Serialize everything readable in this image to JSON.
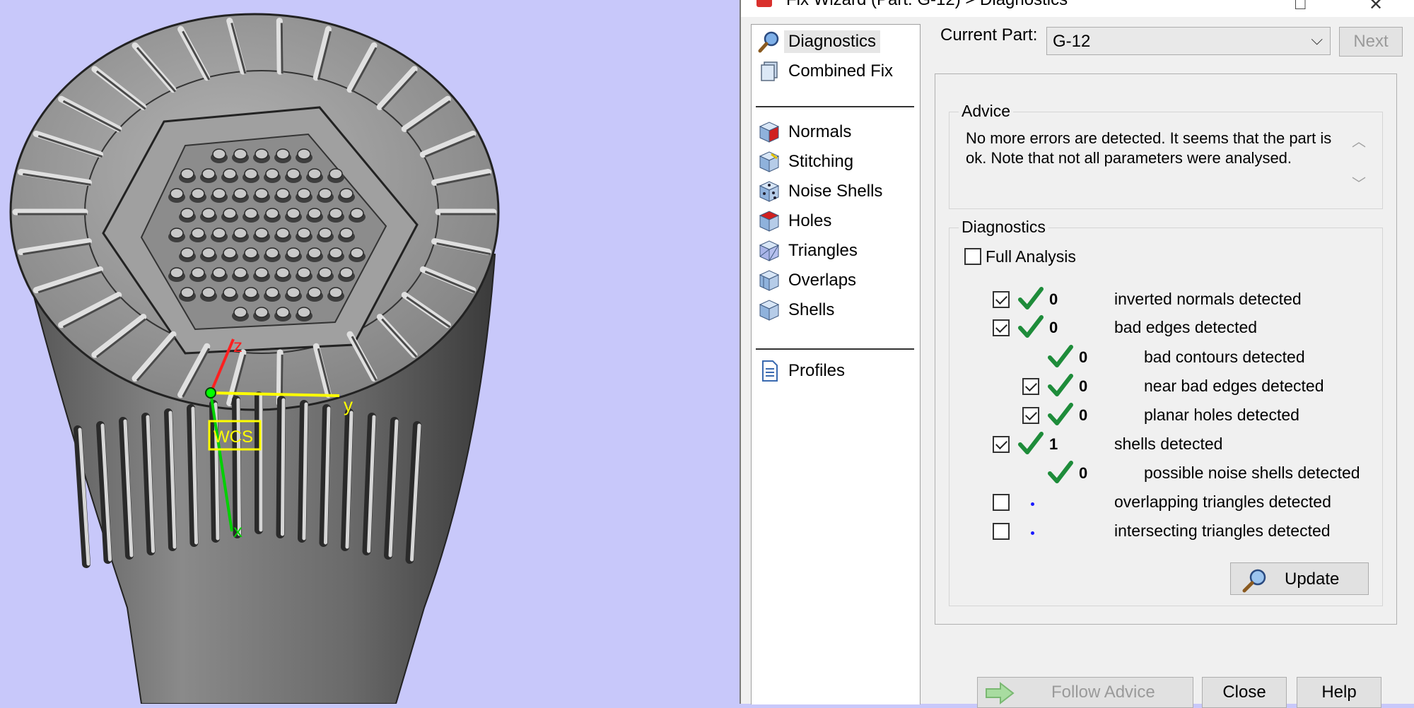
{
  "window": {
    "title": "Fix Wizard (Part: G-12) > Diagnostics",
    "accent_color": "#d9302c"
  },
  "nav": {
    "items": [
      {
        "label": "Diagnostics",
        "icon": "magnifier-icon"
      },
      {
        "label": "Combined Fix",
        "icon": "combined-fix-icon"
      },
      {
        "label": "Normals",
        "icon": "normals-cube-icon"
      },
      {
        "label": "Stitching",
        "icon": "stitching-cube-icon"
      },
      {
        "label": "Noise Shells",
        "icon": "noise-shells-cube-icon"
      },
      {
        "label": "Holes",
        "icon": "holes-cube-icon"
      },
      {
        "label": "Triangles",
        "icon": "triangles-cube-icon"
      },
      {
        "label": "Overlaps",
        "icon": "overlaps-cube-icon"
      },
      {
        "label": "Shells",
        "icon": "shells-cube-icon"
      },
      {
        "label": "Profiles",
        "icon": "document-icon"
      }
    ],
    "selected": "Diagnostics"
  },
  "header": {
    "current_part_label": "Current Part:",
    "current_part_value": "G-12",
    "next_label": "Next"
  },
  "advice": {
    "title": "Advice",
    "text": "No more errors are detected. It seems that the part is ok. Note that not all parameters were analysed."
  },
  "diagnostics": {
    "title": "Diagnostics",
    "full_analysis_label": "Full Analysis",
    "full_analysis_checked": false,
    "rows": [
      {
        "checkbox": true,
        "checked": true,
        "status": "ok",
        "count": "0",
        "label": "inverted normals detected",
        "indent": 0
      },
      {
        "checkbox": true,
        "checked": true,
        "status": "ok",
        "count": "0",
        "label": "bad edges detected",
        "indent": 0
      },
      {
        "checkbox": false,
        "checked": false,
        "status": "ok",
        "count": "0",
        "label": "bad contours detected",
        "indent": 1
      },
      {
        "checkbox": true,
        "checked": true,
        "status": "ok",
        "count": "0",
        "label": "near bad edges detected",
        "indent": 1
      },
      {
        "checkbox": true,
        "checked": true,
        "status": "ok",
        "count": "0",
        "label": "planar holes detected",
        "indent": 1
      },
      {
        "checkbox": true,
        "checked": true,
        "status": "ok",
        "count": "1",
        "label": "shells detected",
        "indent": 0
      },
      {
        "checkbox": false,
        "checked": false,
        "status": "ok",
        "count": "0",
        "label": "possible noise shells detected",
        "indent": 1
      },
      {
        "checkbox": true,
        "checked": false,
        "status": "none",
        "count": "",
        "label": "overlapping triangles detected",
        "indent": 0
      },
      {
        "checkbox": true,
        "checked": false,
        "status": "none",
        "count": "",
        "label": "intersecting triangles detected",
        "indent": 0
      }
    ],
    "update_label": "Update"
  },
  "footer": {
    "follow_advice_label": "Follow Advice",
    "close_label": "Close",
    "help_label": "Help"
  },
  "viewport": {
    "background_color": "#c8c8fa",
    "axes": {
      "x": "x",
      "y": "y",
      "z": "z",
      "wcs": "WCS"
    }
  }
}
